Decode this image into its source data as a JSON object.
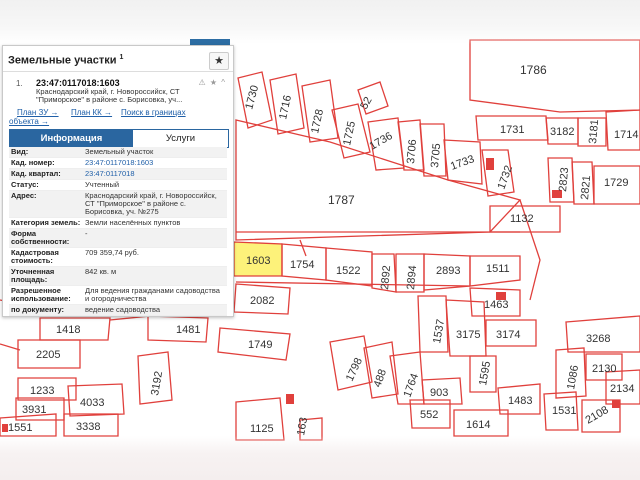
{
  "panel": {
    "title": "Земельные участки",
    "title_sup": "1",
    "pin_icon": "★",
    "result": {
      "index": "1.",
      "cad_number": "23:47:0117018:1603",
      "address": "Краснодарский край, г. Новороссийск, СТ \"Приморское\" в районе с. Борисовка, уч...",
      "icons": "⚠ ★ ^"
    },
    "links": {
      "plan_zu": "План ЗУ →",
      "plan_kk": "План КК →",
      "search": "Поиск в границах",
      "search_cont": "объекта →"
    },
    "tabs": {
      "info": "Информация",
      "services": "Услуги"
    },
    "attributes": [
      {
        "k": "Вид:",
        "v": "Земельный участок",
        "link": false
      },
      {
        "k": "Кад. номер:",
        "v": "23:47:0117018:1603",
        "link": true
      },
      {
        "k": "Кад. квартал:",
        "v": "23:47:0117018",
        "link": true
      },
      {
        "k": "Статус:",
        "v": "Учтенный",
        "link": false
      },
      {
        "k": "Адрес:",
        "v": "Краснодарский край, г. Новороссийск, СТ \"Приморское\" в районе с. Борисовка, уч. №275",
        "link": false
      },
      {
        "k": "Категория земель:",
        "v": "Земли населённых пунктов",
        "link": false
      },
      {
        "k": "Форма собственности:",
        "v": "-",
        "link": false
      },
      {
        "k": "Кадастровая стоимость:",
        "v": "709 359,74 руб.",
        "link": false
      },
      {
        "k": "Уточненная площадь:",
        "v": "842 кв. м",
        "link": false
      },
      {
        "k": "Разрешенное использование:",
        "v": "Для ведения гражданами садоводства и огородничества",
        "link": false
      },
      {
        "k": "по документу:",
        "v": "ведение садоводства",
        "link": false
      }
    ]
  },
  "map": {
    "parcel_color": "#e0403c",
    "highlight_color": "#fdf27a",
    "labels": {
      "p1786": "1786",
      "p1730": "1730",
      "p1716": "1716",
      "p1728": "1728",
      "p52": "52",
      "p1725": "1725",
      "p1736": "1736",
      "p3706": "3706",
      "p3705": "3705",
      "p1733": "1733",
      "p1731": "1731",
      "p3182": "3182",
      "p3181": "3181",
      "p1714": "1714",
      "p1732": "1732",
      "p2823": "2823",
      "p2821": "2821",
      "p1729": "1729",
      "p1787": "1787",
      "p1132": "1132",
      "p1603": "1603",
      "p1754": "1754",
      "p1522": "1522",
      "p2892": "2892",
      "p2894": "2894",
      "p2893": "2893",
      "p1511": "1511",
      "p2082": "2082",
      "p1463": "1463",
      "p1537": "1537",
      "p3175": "3175",
      "p3174": "3174",
      "p3268": "3268",
      "p1418": "1418",
      "p1481": "1481",
      "p1749": "1749",
      "p2205": "2205",
      "p1798": "1798",
      "p488": "488",
      "p1764": "1764",
      "p1595": "1595",
      "p1086": "1086",
      "p2130": "2130",
      "p3192": "3192",
      "p1233": "1233",
      "p4033": "4033",
      "p3931": "3931",
      "p3338": "3338",
      "p1551": "1551",
      "p903": "903",
      "p552": "552",
      "p1614": "1614",
      "p1483": "1483",
      "p1531": "1531",
      "p2108": "2108",
      "p163": "163",
      "p1125": "1125",
      "p2134": "2134"
    }
  }
}
